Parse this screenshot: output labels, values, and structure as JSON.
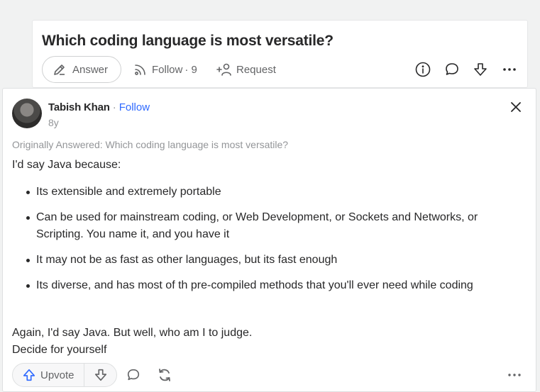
{
  "question": {
    "title": "Which coding language is most versatile?",
    "answer_label": "Answer",
    "follow_label": "Follow",
    "follow_count": "· 9",
    "request_label": "Request",
    "icons": [
      "pencil-icon",
      "follow-icon",
      "request-icon",
      "info-icon",
      "comment-icon",
      "downvote-icon",
      "more-icon"
    ]
  },
  "answer": {
    "author_name": "Tabish Khan",
    "separator": "·",
    "follow_label": "Follow",
    "age": "8y",
    "originally_answered": "Originally Answered: Which coding language is most versatile?",
    "intro": "I'd say Java because:",
    "bullets": [
      "Its extensible and extremely portable",
      "Can be used for mainstream coding, or Web Development, or Sockets and Networks, or Scripting. You name it, and you have it",
      "It may not be as fast as other languages, but its fast enough",
      "Its diverse, and has most of th pre-compiled methods that you'll ever need while coding"
    ],
    "closing_line1": "Again, I'd say Java. But well, who am I to judge.",
    "closing_line2": "Decide for yourself",
    "upvote_label": "Upvote"
  },
  "colors": {
    "accent": "#2e69ff",
    "text": "#282829",
    "muted": "#939598",
    "icon": "#636466"
  }
}
